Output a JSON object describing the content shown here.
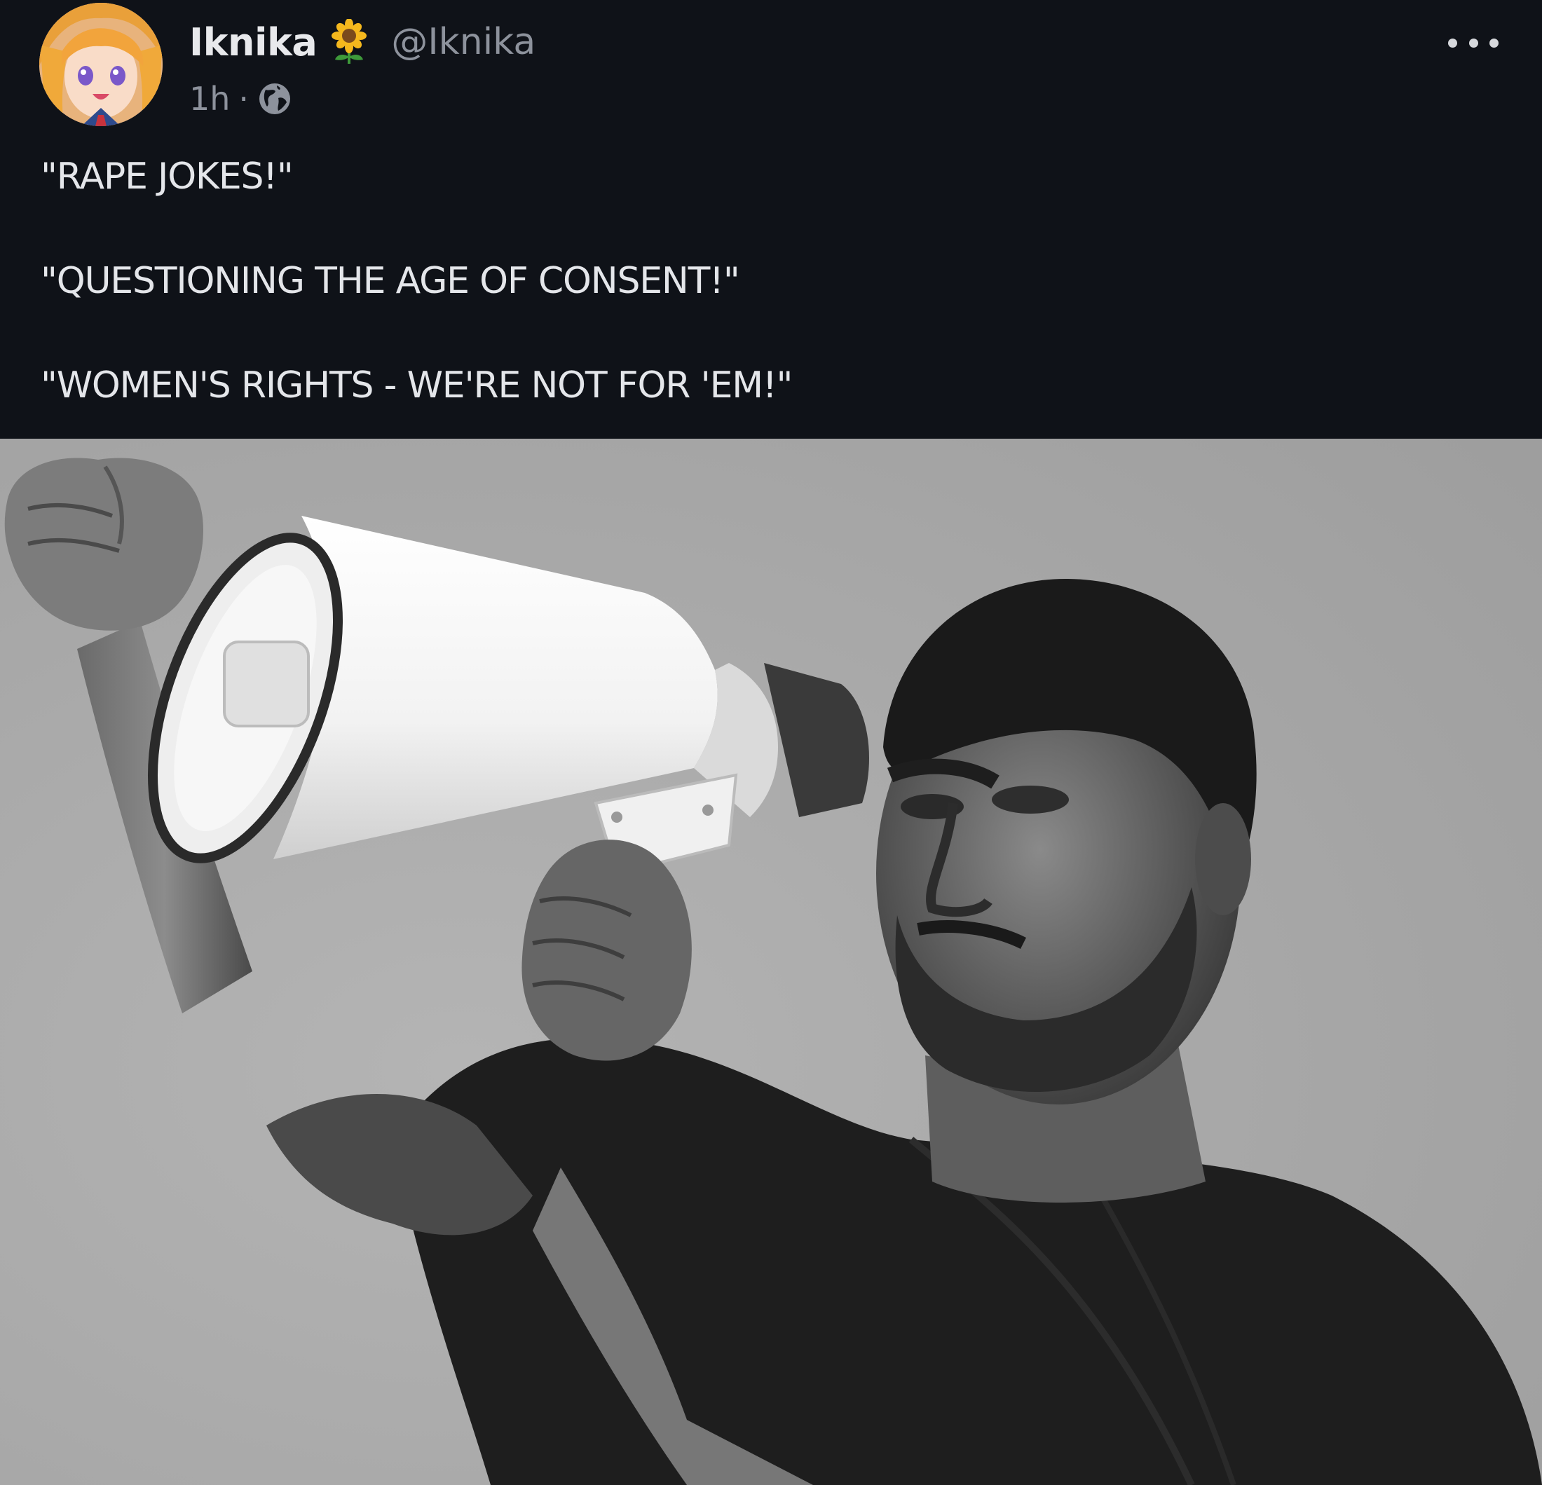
{
  "author": {
    "display_name": "Iknika",
    "handle": "@Iknika",
    "flair_icon": "sunflower-icon",
    "avatar_icon": "anime-avatar"
  },
  "meta": {
    "time": "1h",
    "separator": "·",
    "visibility_icon": "globe-icon"
  },
  "menu": {
    "more_icon": "ellipsis-icon"
  },
  "post": {
    "lines": [
      "\"RAPE JOKES!\"",
      "\"QUESTIONING THE AGE OF CONSENT!\"",
      "\"WOMEN'S RIGHTS - WE'RE NOT FOR 'EM!\""
    ]
  },
  "media": {
    "description_icon": "megaphone-man-image"
  },
  "colors": {
    "background": "#0f1218",
    "text": "#e4e6ea",
    "muted": "#8d929c",
    "image_background": "#a7a7a7"
  }
}
